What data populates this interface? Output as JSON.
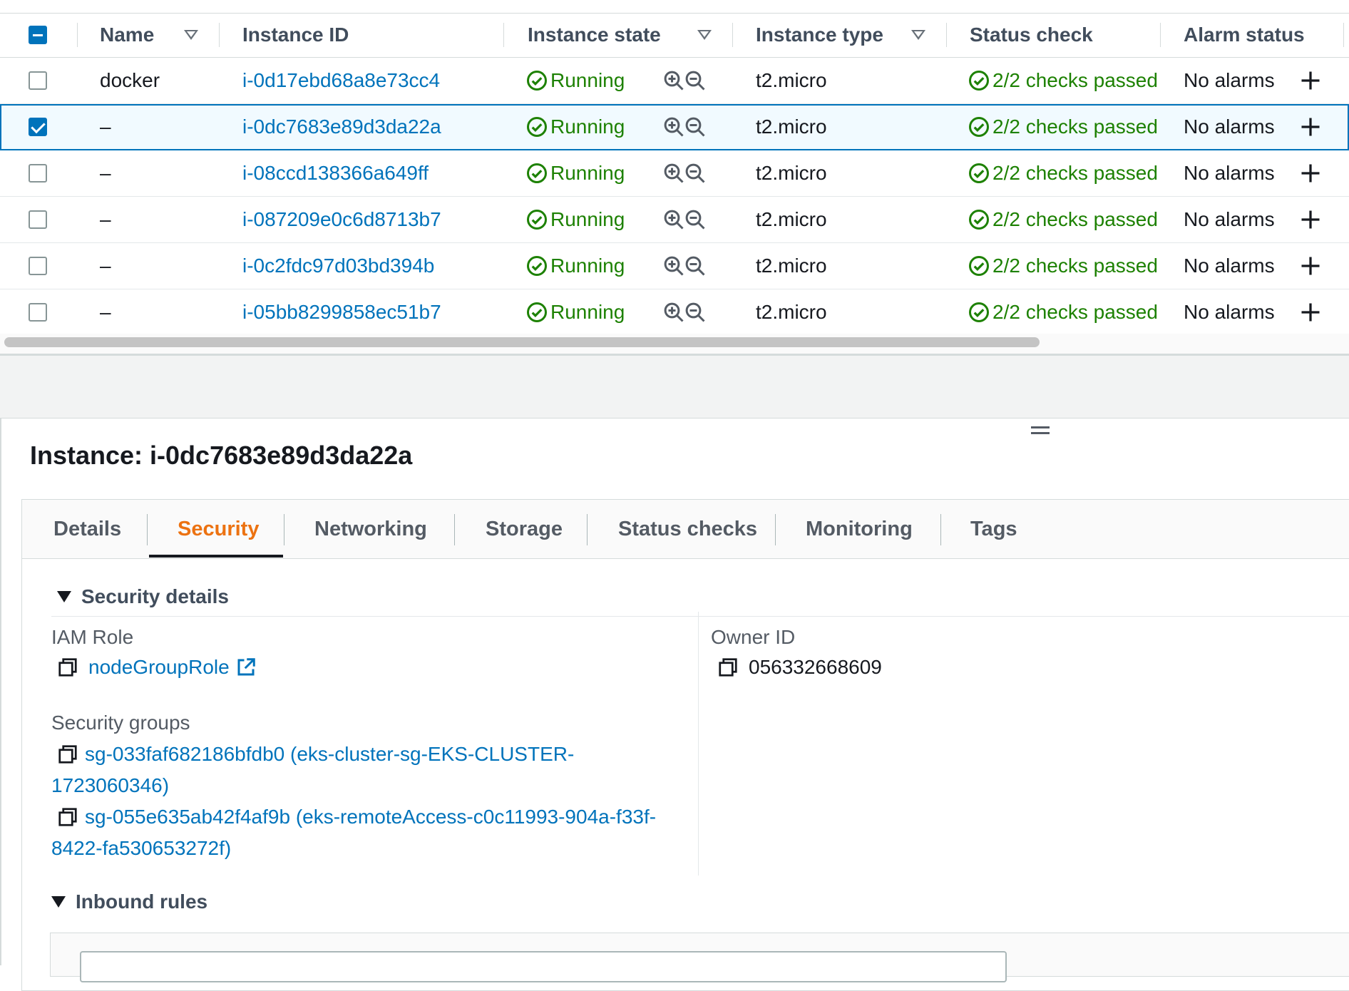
{
  "table": {
    "headers": {
      "name": "Name",
      "instance_id": "Instance ID",
      "instance_state": "Instance state",
      "instance_type": "Instance type",
      "status_check": "Status check",
      "alarm_status": "Alarm status"
    },
    "rows": [
      {
        "name": "docker",
        "id": "i-0d17ebd68a8e73cc4",
        "state": "Running",
        "type": "t2.micro",
        "status": "2/2 checks passed",
        "alarm": "No alarms",
        "selected": false
      },
      {
        "name": "–",
        "id": "i-0dc7683e89d3da22a",
        "state": "Running",
        "type": "t2.micro",
        "status": "2/2 checks passed",
        "alarm": "No alarms",
        "selected": true
      },
      {
        "name": "–",
        "id": "i-08ccd138366a649ff",
        "state": "Running",
        "type": "t2.micro",
        "status": "2/2 checks passed",
        "alarm": "No alarms",
        "selected": false
      },
      {
        "name": "–",
        "id": "i-087209e0c6d8713b7",
        "state": "Running",
        "type": "t2.micro",
        "status": "2/2 checks passed",
        "alarm": "No alarms",
        "selected": false
      },
      {
        "name": "–",
        "id": "i-0c2fdc97d03bd394b",
        "state": "Running",
        "type": "t2.micro",
        "status": "2/2 checks passed",
        "alarm": "No alarms",
        "selected": false
      },
      {
        "name": "–",
        "id": "i-05bb8299858ec51b7",
        "state": "Running",
        "type": "t2.micro",
        "status": "2/2 checks passed",
        "alarm": "No alarms",
        "selected": false
      }
    ]
  },
  "detail": {
    "title": "Instance: i-0dc7683e89d3da22a",
    "tabs": [
      "Details",
      "Security",
      "Networking",
      "Storage",
      "Status checks",
      "Monitoring",
      "Tags"
    ],
    "active_tab": "Security",
    "security_details": {
      "heading": "Security details",
      "iam_role_label": "IAM Role",
      "iam_role_value": "nodeGroupRole",
      "owner_id_label": "Owner ID",
      "owner_id_value": "056332668609",
      "security_groups_label": "Security groups",
      "sg1_line1": "sg-033faf682186bfdb0 (eks-cluster-sg-EKS-CLUSTER-",
      "sg1_line2": "1723060346)",
      "sg2_line1": "sg-055e635ab42f4af9b (eks-remoteAccess-c0c11993-904a-f33f-",
      "sg2_line2": "8422-fa530653272f)"
    },
    "inbound_rules_heading": "Inbound rules"
  },
  "colors": {
    "link": "#0073bb",
    "success": "#1d8102",
    "active_tab": "#ec7211",
    "selected_row_bg": "#f1faff"
  },
  "icons": [
    "check-circle-icon",
    "zoom-in-icon",
    "zoom-out-icon",
    "plus-icon",
    "copy-icon",
    "external-link-icon",
    "sort-icon",
    "caret-down-icon",
    "drag-handle-icon"
  ]
}
